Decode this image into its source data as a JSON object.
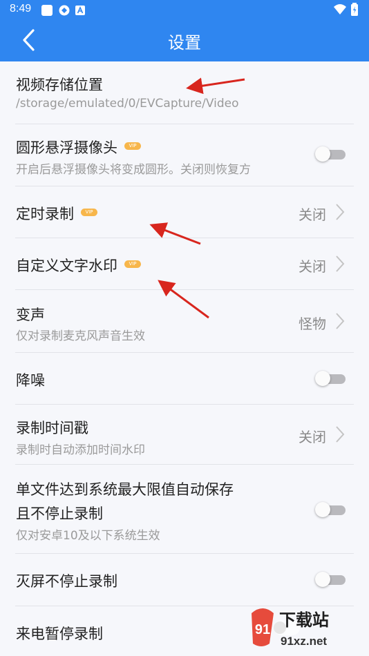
{
  "status": {
    "time": "8:49",
    "icons": [
      "square-icon",
      "sync-icon",
      "font-a-icon",
      "wifi-icon",
      "battery-icon"
    ]
  },
  "header": {
    "title": "设置",
    "back_icon": "chevron-left-icon"
  },
  "settings": {
    "video_location": {
      "label": "视频存储位置",
      "sub": "/storage/emulated/0/EVCapture/Video"
    },
    "round_camera": {
      "label": "圆形悬浮摄像头",
      "vip": "VIP",
      "sub": "开启后悬浮摄像头将变成圆形。关闭则恢复方",
      "enabled": false
    },
    "timed_record": {
      "label": "定时录制",
      "vip": "VIP",
      "value": "关闭"
    },
    "text_watermark": {
      "label": "自定义文字水印",
      "vip": "VIP",
      "value": "关闭"
    },
    "voice_change": {
      "label": "变声",
      "sub": "仅对录制麦克风声音生效",
      "value": "怪物"
    },
    "noise_reduce": {
      "label": "降噪",
      "enabled": false
    },
    "timestamp": {
      "label": "录制时间戳",
      "sub": "录制时自动添加时间水印",
      "value": "关闭"
    },
    "auto_save": {
      "label_line1": "单文件达到系统最大限值自动保存",
      "label_line2": "且不停止录制",
      "sub": "仅对安卓10及以下系统生效",
      "enabled": false
    },
    "screen_off": {
      "label": "灭屏不停止录制",
      "enabled": false
    },
    "call_pause": {
      "label": "来电暂停录制"
    }
  },
  "watermark": {
    "brand": "下载站",
    "url": "91xz.net",
    "logo_text": "91"
  },
  "colors": {
    "topbar": "#2f86f0",
    "vip": "#f7b64b",
    "arrow": "#d8261e"
  }
}
